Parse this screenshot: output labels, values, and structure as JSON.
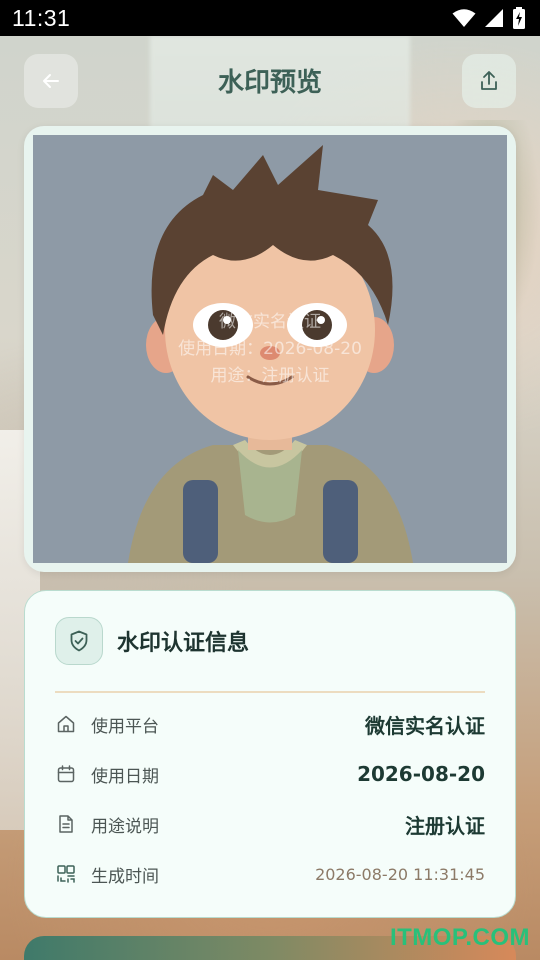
{
  "status": {
    "time": "11:31"
  },
  "topbar": {
    "title": "水印预览",
    "back_icon": "arrow-left-icon",
    "share_icon": "share-icon"
  },
  "watermark": {
    "line1": "微信实名认证",
    "line2": "使用日期：2026-08-20",
    "line3": "用途：注册认证"
  },
  "info": {
    "title": "水印认证信息",
    "rows": [
      {
        "label": "使用平台",
        "value": "微信实名认证",
        "icon": "home-icon"
      },
      {
        "label": "使用日期",
        "value": "2026-08-20",
        "icon": "calendar-icon"
      },
      {
        "label": "用途说明",
        "value": "注册认证",
        "icon": "document-icon"
      },
      {
        "label": "生成时间",
        "value": "2026-08-20 11:31:45",
        "icon": "qr-scan-icon"
      }
    ]
  },
  "brand": "ITMOP.COM",
  "colors": {
    "accent": "#3d6157",
    "card_border": "#b9dccf",
    "divider": "#ecdcc0"
  }
}
